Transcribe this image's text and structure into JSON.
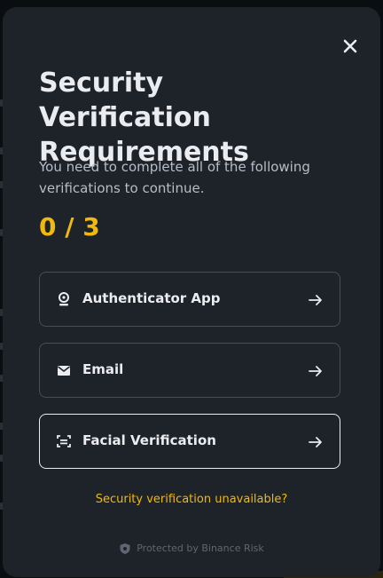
{
  "modal": {
    "title": "Security Verification Requirements",
    "description": "You need to complete all of the following verifications to continue.",
    "progress": "0 / 3",
    "options": [
      {
        "label": "Authenticator App",
        "icon": "authenticator-icon"
      },
      {
        "label": "Email",
        "icon": "email-icon"
      },
      {
        "label": "Facial Verification",
        "icon": "face-id-icon"
      }
    ],
    "unavailable_link": "Security verification unavailable?",
    "footer_text": "Protected by Binance Risk"
  },
  "colors": {
    "accent": "#f0b90b",
    "modal_bg": "#1e2329",
    "text_primary": "#eaecef",
    "text_secondary": "#b7bdc6",
    "border": "#474d57"
  }
}
